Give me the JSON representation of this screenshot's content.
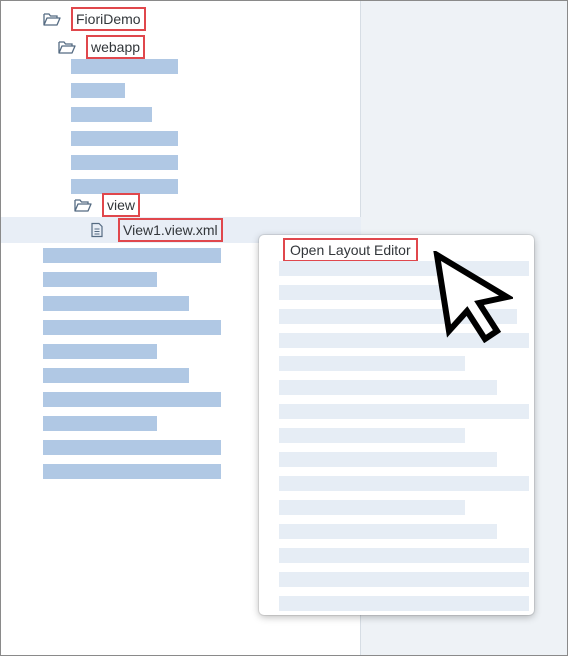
{
  "tree": {
    "root_folder": {
      "label": "FioriDemo",
      "icon": "folder-open-icon"
    },
    "webapp_folder": {
      "label": "webapp",
      "icon": "folder-open-icon"
    },
    "view_folder": {
      "label": "view",
      "icon": "folder-open-icon"
    },
    "selected_file": {
      "label": "View1.view.xml",
      "icon": "document-icon"
    }
  },
  "context_menu": {
    "first_item": "Open Layout Editor"
  },
  "colors": {
    "highlight_border": "#e0474c",
    "placeholder_bar": "#b0c8e4",
    "menu_placeholder_bar": "#e6edf5",
    "selected_row": "#e8eef6",
    "right_pane": "#eef2f6"
  }
}
